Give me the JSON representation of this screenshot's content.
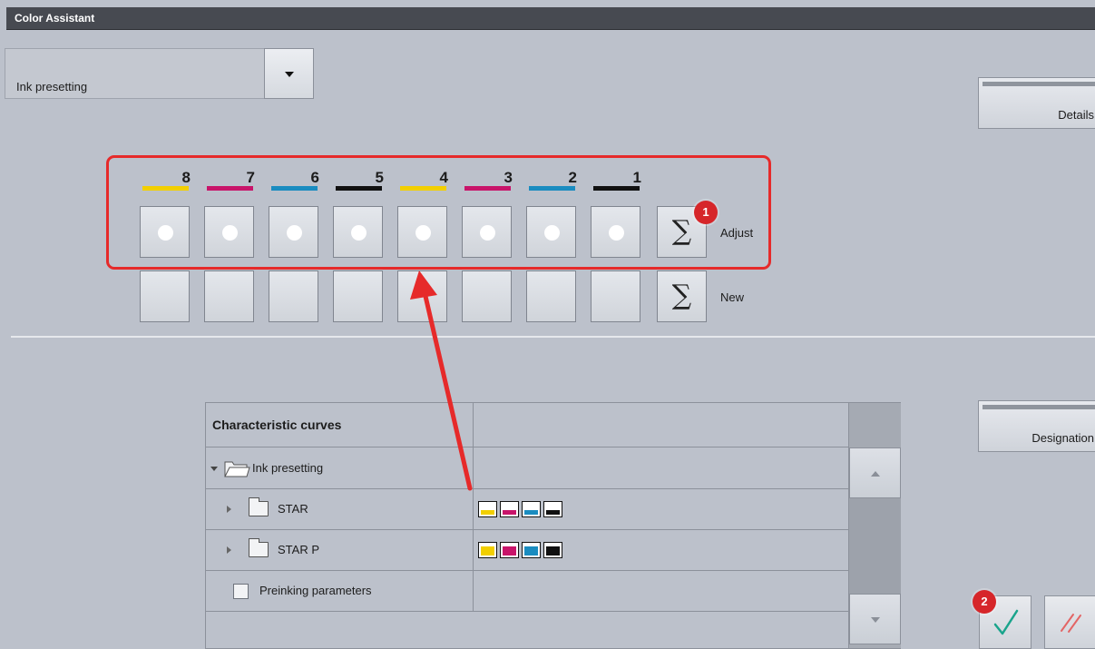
{
  "window": {
    "title": "Color Assistant"
  },
  "dropdown": {
    "value": "Ink presetting"
  },
  "side_buttons": {
    "details": "Details",
    "designation": "Designation"
  },
  "inks": [
    {
      "number": "8",
      "color": "#f2cf00"
    },
    {
      "number": "7",
      "color": "#c8146a"
    },
    {
      "number": "6",
      "color": "#1a8cc0"
    },
    {
      "number": "5",
      "color": "#111111"
    },
    {
      "number": "4",
      "color": "#f2cf00"
    },
    {
      "number": "3",
      "color": "#c8146a"
    },
    {
      "number": "2",
      "color": "#1a8cc0"
    },
    {
      "number": "1",
      "color": "#111111"
    }
  ],
  "rows": {
    "adjust_label": "Adjust",
    "new_label": "New",
    "sigma_symbol": "∑"
  },
  "badges": {
    "one": "1",
    "two": "2"
  },
  "table": {
    "header": "Characteristic curves",
    "items": [
      {
        "name": "Ink presetting"
      },
      {
        "name": "STAR"
      },
      {
        "name": "STAR P"
      },
      {
        "name": "Preinking parameters"
      }
    ],
    "swatch_colors": [
      "#f2cf00",
      "#c8146a",
      "#1a8cc0",
      "#111111"
    ]
  },
  "icons": {
    "dropdown": "chevron-down-icon",
    "ok": "checkmark-icon",
    "cancel": "cancel-slashes-icon",
    "scroll_up": "arrow-up-icon",
    "scroll_down": "arrow-down-icon"
  },
  "colors": {
    "ok_check": "#1aa48c",
    "cancel_slash": "#e36565",
    "highlight": "#e62a2a"
  }
}
